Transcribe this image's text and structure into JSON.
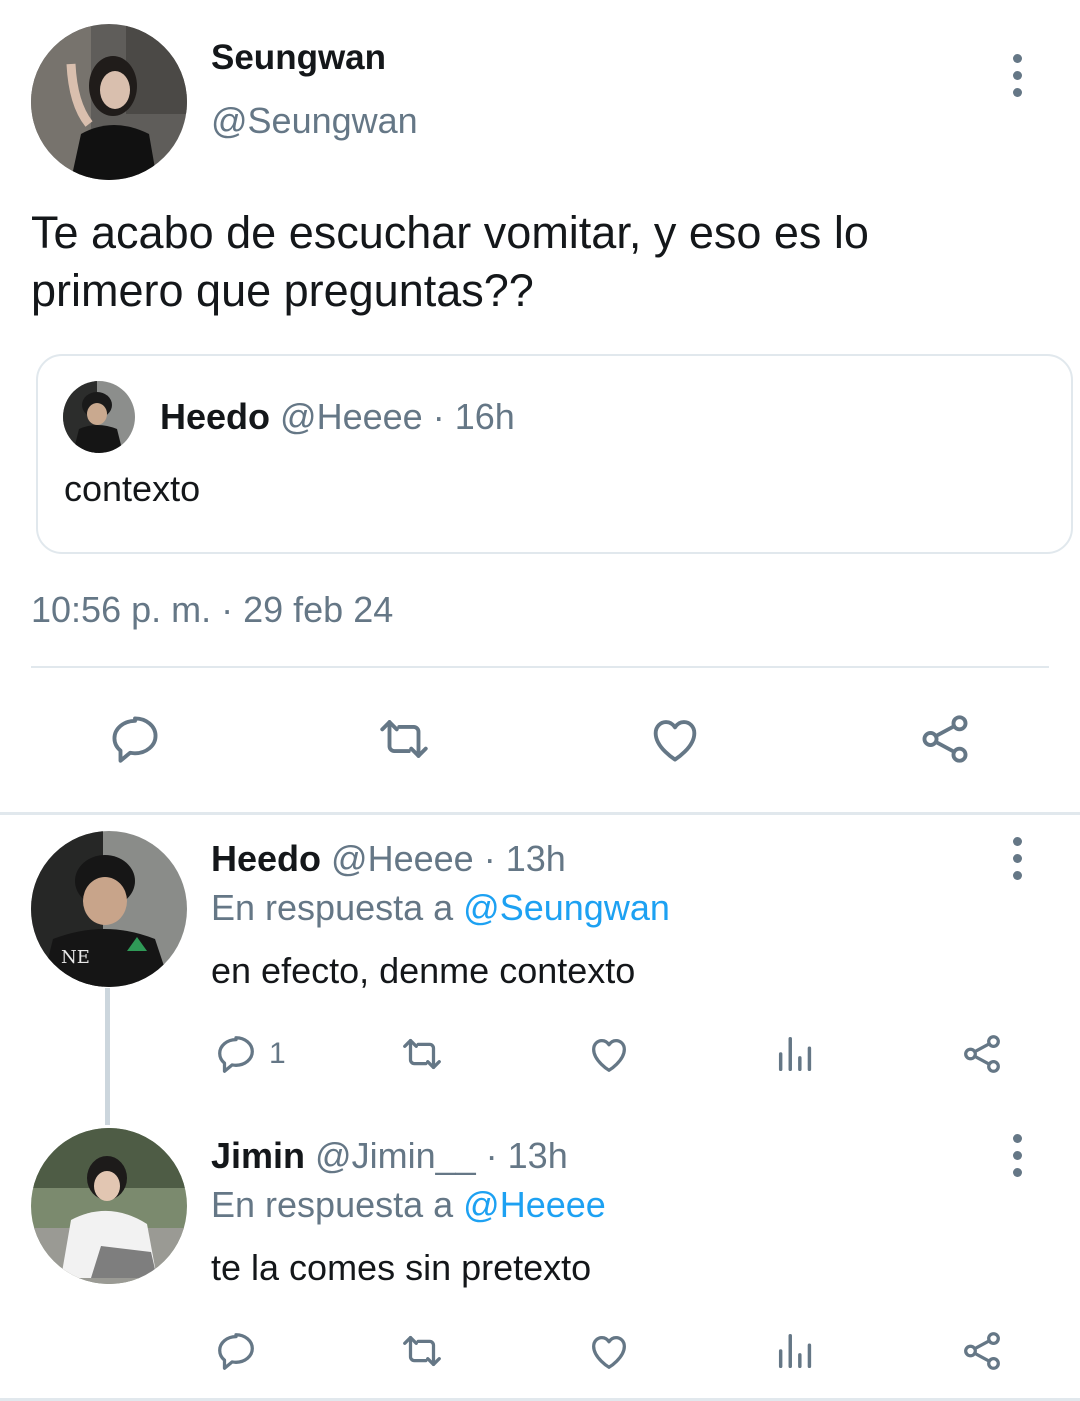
{
  "main_tweet": {
    "display_name": "Seungwan",
    "handle": "@Seungwan",
    "text_line1": "Te acabo de escuchar vomitar, y eso es lo",
    "text_line2": "primero que preguntas??",
    "quoted": {
      "display_name": "Heedo",
      "handle": "@Heeee",
      "time": "· 16h",
      "text": "contexto"
    },
    "timestamp": "10:56 p. m. · 29 feb 24",
    "actions": [
      "reply-icon",
      "retweet-icon",
      "like-icon",
      "share-icon"
    ]
  },
  "replies": [
    {
      "display_name": "Heedo",
      "handle": "@Heeee",
      "time": "· 13h",
      "in_reply_prefix": "En respuesta a",
      "in_reply_to": "@Seungwan",
      "text": "en efecto, denme contexto",
      "reply_count": "1"
    },
    {
      "display_name": "Jimin",
      "handle": "@Jimin__",
      "time": "· 13h",
      "in_reply_prefix": "En respuesta a",
      "in_reply_to": "@Heeee",
      "text": "te la comes sin pretexto",
      "reply_count": ""
    }
  ],
  "colors": {
    "icon_gray": "#657786",
    "link_blue": "#1da1f2",
    "border": "#e1e8ed"
  }
}
